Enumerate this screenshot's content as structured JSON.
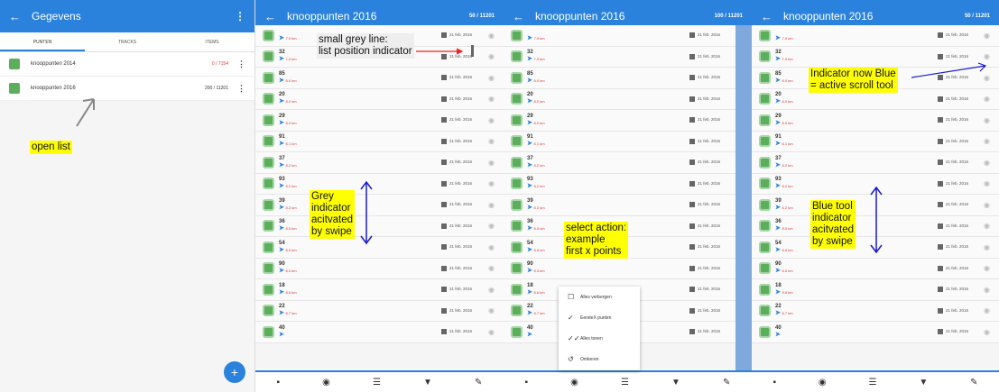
{
  "panel1": {
    "title": "Gegevens",
    "tabs": [
      "PUNTEN",
      "TRACKS",
      "ITEMS"
    ],
    "datasets": [
      {
        "name": "knooppunten 2014",
        "count": "0 / 7154",
        "red": true
      },
      {
        "name": "knooppunten 2016",
        "count": "200 / 11201",
        "red": false
      }
    ],
    "fab": "+"
  },
  "panel2": {
    "title": "knooppunten 2016",
    "count": "50 / 11201"
  },
  "panel3": {
    "title": "knooppunten 2016",
    "count": "100 / 11201"
  },
  "panel4": {
    "title": "knooppunten 2016",
    "count": "50 / 11201"
  },
  "rows": [
    {
      "num": "",
      "dist": "7.9 km",
      "date": "21 feb. 2016"
    },
    {
      "num": "32",
      "dist": "7.9 km",
      "date": "21 feb. 2016"
    },
    {
      "num": "85",
      "dist": "8.0 km",
      "date": "21 feb. 2016"
    },
    {
      "num": "20",
      "dist": "8.0 km",
      "date": "21 feb. 2016"
    },
    {
      "num": "29",
      "dist": "8.0 km",
      "date": "21 feb. 2016"
    },
    {
      "num": "91",
      "dist": "8.1 km",
      "date": "21 feb. 2016"
    },
    {
      "num": "37",
      "dist": "8.2 km",
      "date": "21 feb. 2016"
    },
    {
      "num": "93",
      "dist": "8.2 km",
      "date": "21 feb. 2016"
    },
    {
      "num": "39",
      "dist": "8.2 km",
      "date": "21 feb. 2016"
    },
    {
      "num": "36",
      "dist": "8.5 km",
      "date": "21 feb. 2016"
    },
    {
      "num": "54",
      "dist": "8.5 km",
      "date": "21 feb. 2016"
    },
    {
      "num": "90",
      "dist": "8.5 km",
      "date": "21 feb. 2016"
    },
    {
      "num": "18",
      "dist": "8.6 km",
      "date": "21 feb. 2016"
    },
    {
      "num": "22",
      "dist": "8.7 km",
      "date": "21 feb. 2016"
    },
    {
      "num": "40",
      "dist": "",
      "date": "21 feb. 2016"
    }
  ],
  "popup": [
    {
      "icon": "☐",
      "label": "Alles verbergen"
    },
    {
      "icon": "✓",
      "label": "EersteX punten"
    },
    {
      "icon": "✓✓",
      "label": "Alles tonen"
    },
    {
      "icon": "↺",
      "label": "Omkeren"
    }
  ],
  "toolbar": [
    "▪",
    "◉",
    "☰",
    "▼",
    "✎"
  ],
  "annotations": {
    "open_list": "open list",
    "grey_line": "small grey line:\nlist position indicator",
    "grey_indicator": "Grey\nindicator\nacitvated\nby swipe",
    "select_action": "select action:\nexample\nfirst x points",
    "now_blue": "Indicator now Blue\n= active scroll tool",
    "blue_tool": "Blue tool\nindicator\nacitvated\nby swipe"
  },
  "colors": {
    "accent": "#2a82dc",
    "highlight": "#ffff00",
    "green": "#5cad5c"
  }
}
